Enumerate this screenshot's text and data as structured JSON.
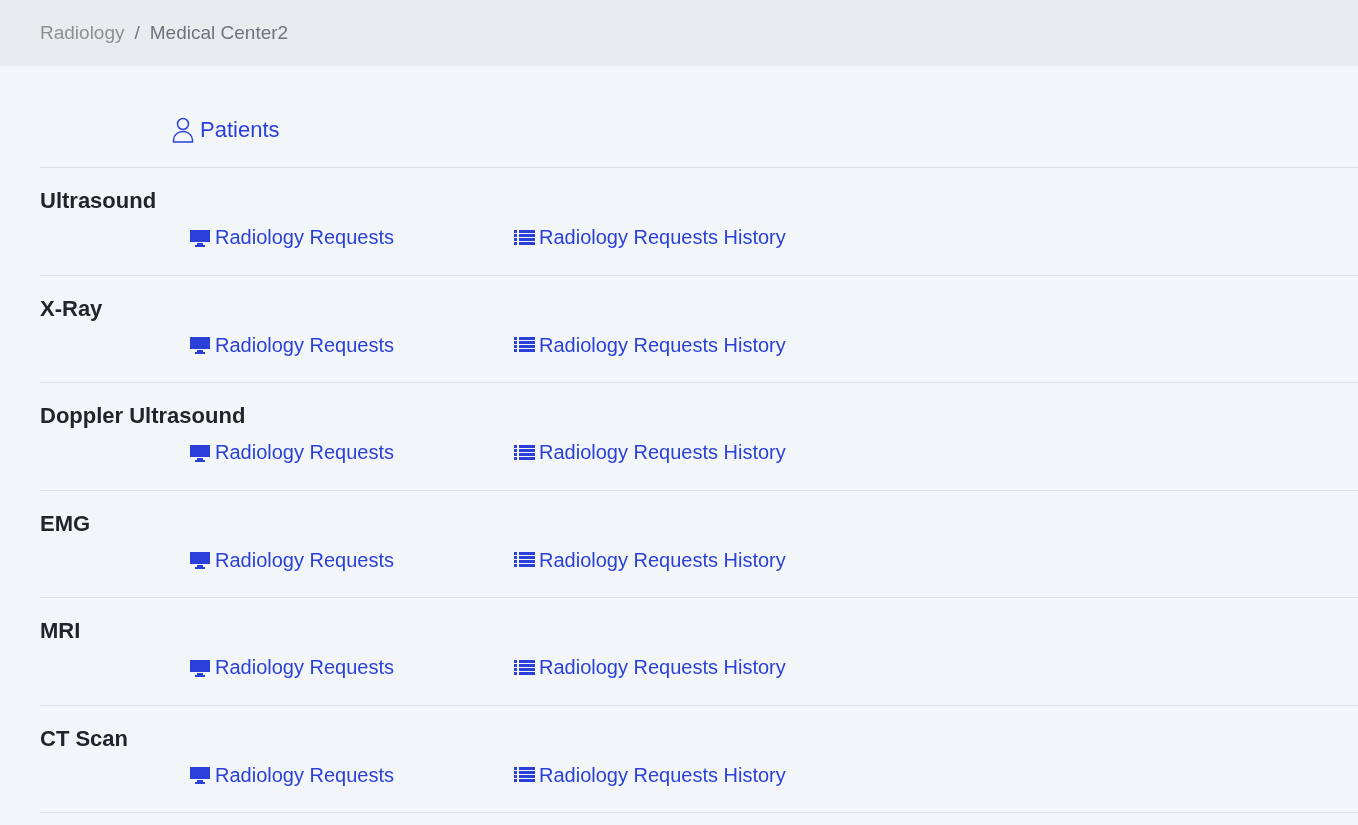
{
  "breadcrumb": [
    {
      "label": "Radiology",
      "kind": "link"
    },
    {
      "label": "/",
      "kind": "separator"
    },
    {
      "label": "Medical Center2",
      "kind": "current"
    }
  ],
  "patients_link": {
    "label": "Patients"
  },
  "sections": [
    {
      "title": "Ultrasound",
      "links": [
        {
          "kind": "monitor",
          "label": "Radiology Requests"
        },
        {
          "kind": "list",
          "label": "Radiology Requests History"
        }
      ]
    },
    {
      "title": "X-Ray",
      "links": [
        {
          "kind": "monitor",
          "label": "Radiology Requests"
        },
        {
          "kind": "list",
          "label": "Radiology Requests History"
        }
      ]
    },
    {
      "title": "Doppler Ultrasound",
      "links": [
        {
          "kind": "monitor",
          "label": "Radiology Requests"
        },
        {
          "kind": "list",
          "label": "Radiology Requests History"
        }
      ]
    },
    {
      "title": "EMG",
      "links": [
        {
          "kind": "monitor",
          "label": "Radiology Requests"
        },
        {
          "kind": "list",
          "label": "Radiology Requests History"
        }
      ]
    },
    {
      "title": "MRI",
      "links": [
        {
          "kind": "monitor",
          "label": "Radiology Requests"
        },
        {
          "kind": "list",
          "label": "Radiology Requests History"
        }
      ]
    },
    {
      "title": "CT Scan",
      "links": [
        {
          "kind": "monitor",
          "label": "Radiology Requests"
        },
        {
          "kind": "list",
          "label": "Radiology Requests History"
        }
      ]
    }
  ]
}
